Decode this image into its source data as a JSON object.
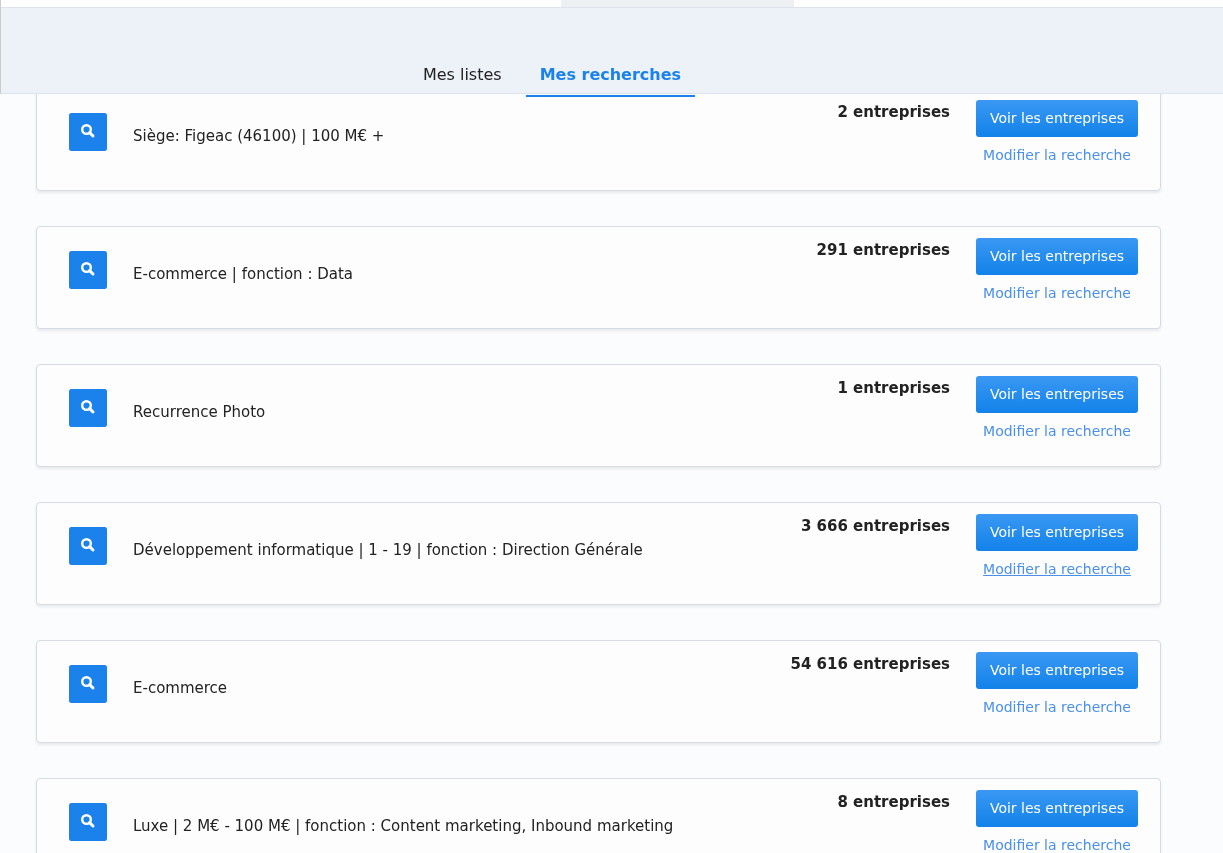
{
  "tabs": [
    {
      "label": "Mes listes",
      "selected": false
    },
    {
      "label": "Mes recherches",
      "selected": true
    }
  ],
  "searches": [
    {
      "description": "Siège: Figeac (46100) | 100 M€ +",
      "count": "2 entreprises",
      "button": "Voir les entreprises",
      "link": "Modifier la recherche",
      "hovered": false
    },
    {
      "description": "E-commerce | fonction : Data",
      "count": "291 entreprises",
      "button": "Voir les entreprises",
      "link": "Modifier la recherche",
      "hovered": false
    },
    {
      "description": "Recurrence Photo",
      "count": "1 entreprises",
      "button": "Voir les entreprises",
      "link": "Modifier la recherche",
      "hovered": false
    },
    {
      "description": "Développement informatique | 1 - 19 | fonction : Direction Générale",
      "count": "3 666 entreprises",
      "button": "Voir les entreprises",
      "link": "Modifier la recherche",
      "hovered": true
    },
    {
      "description": "E-commerce",
      "count": "54 616 entreprises",
      "button": "Voir les entreprises",
      "link": "Modifier la recherche",
      "hovered": false
    },
    {
      "description": "Luxe | 2 M€ - 100 M€ | fonction : Content marketing, Inbound marketing",
      "count": "8 entreprises",
      "button": "Voir les entreprises",
      "link": "Modifier la recherche",
      "hovered": false
    }
  ]
}
